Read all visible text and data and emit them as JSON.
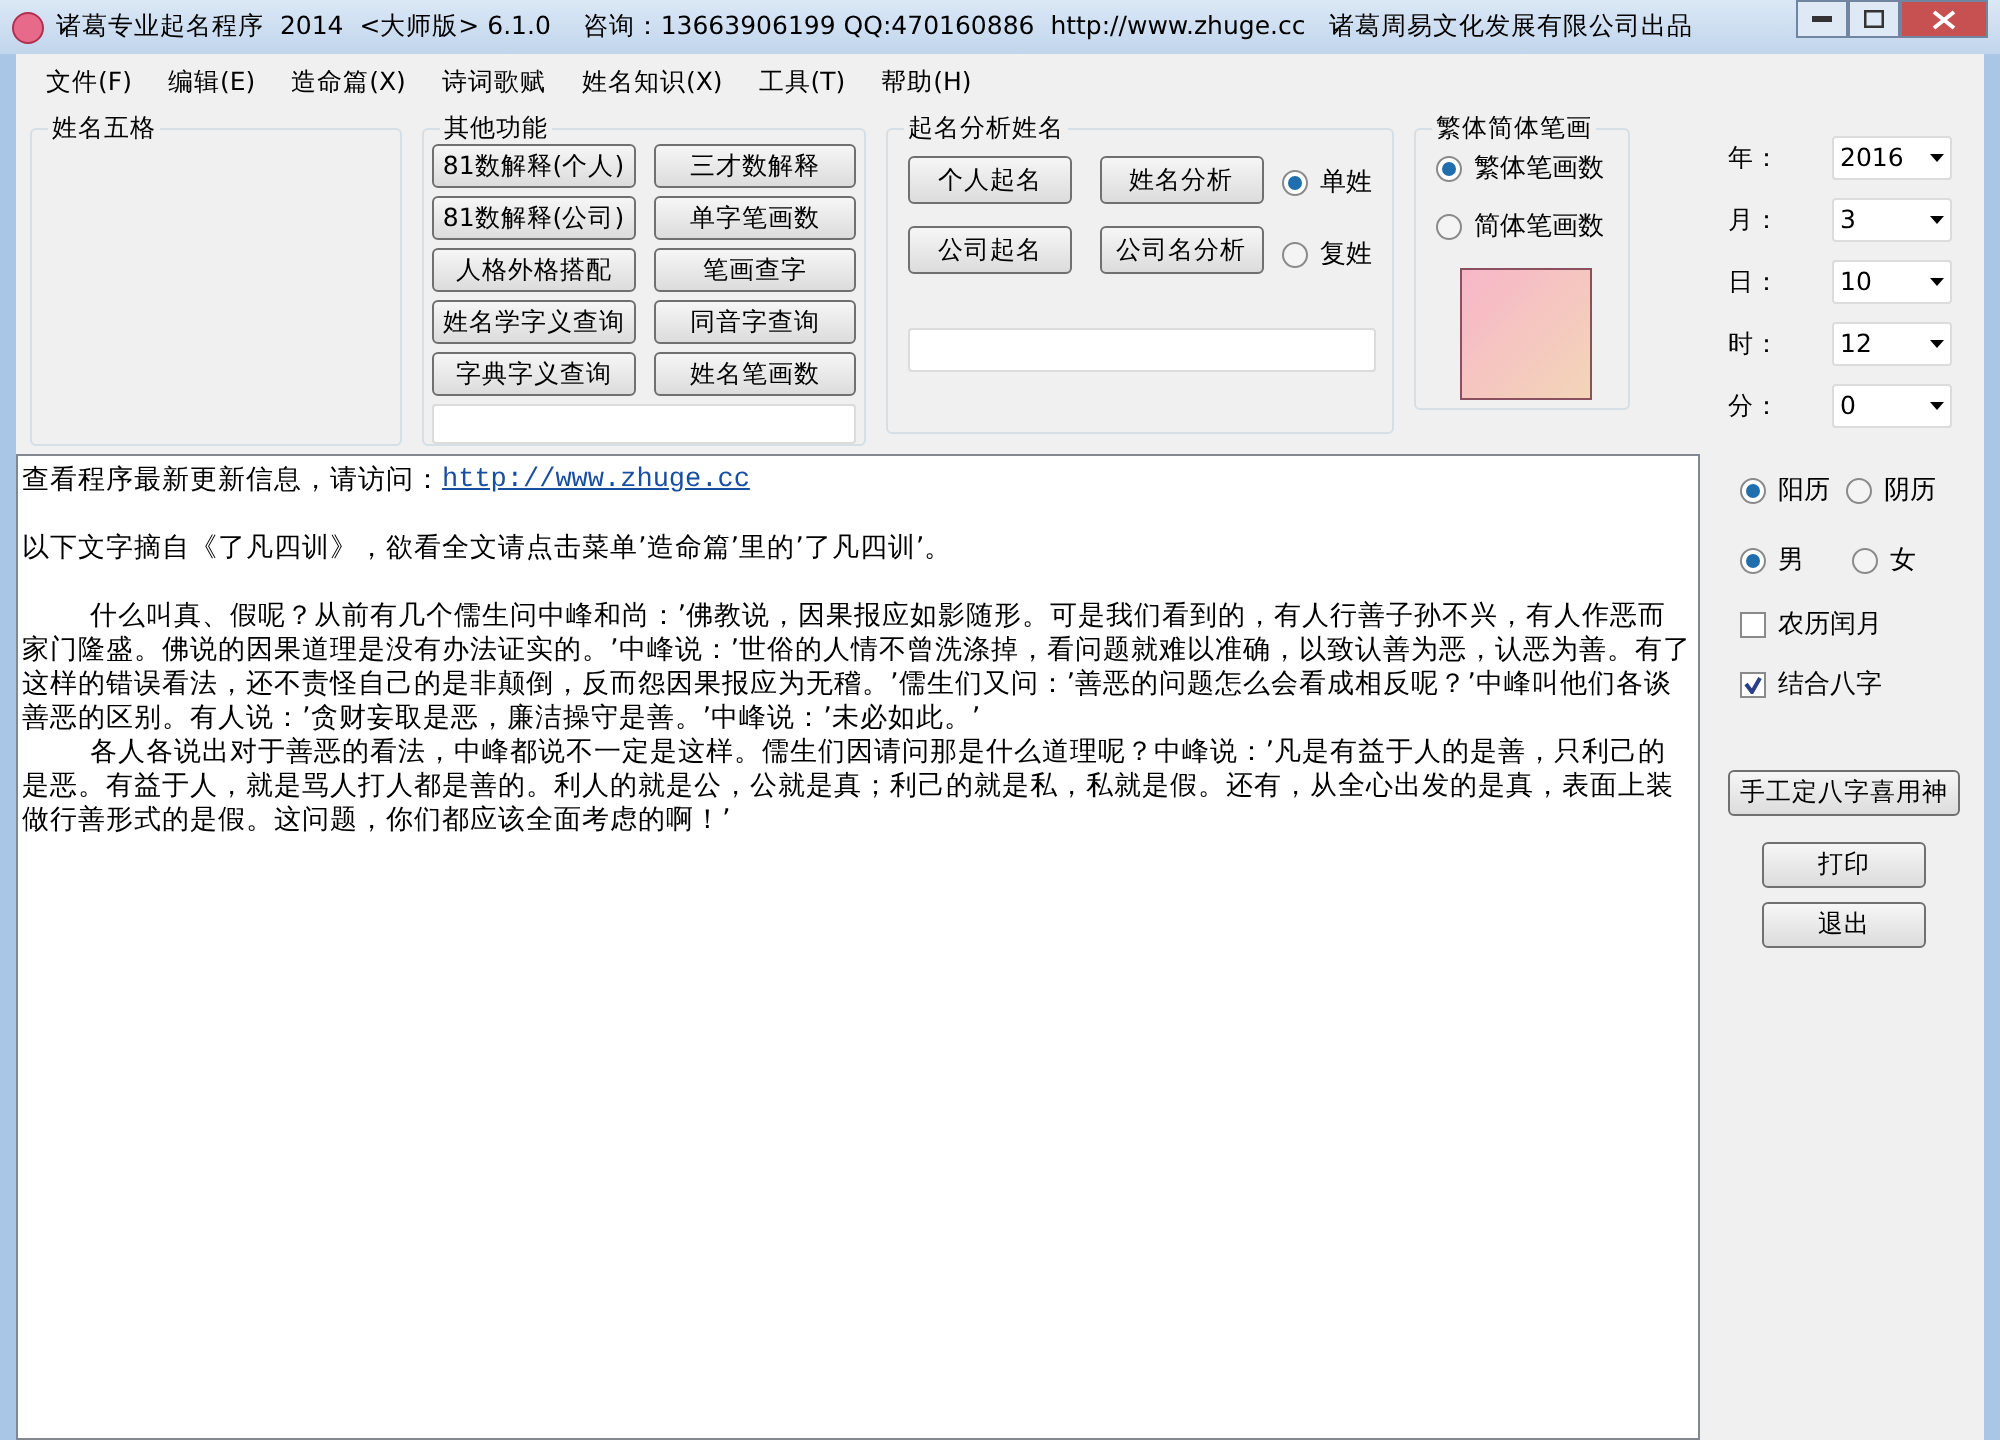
{
  "window": {
    "title": "诸葛专业起名程序  2014  <大师版> 6.1.0    咨询：13663906199 QQ:470160886  http://www.zhuge.cc   诸葛周易文化发展有限公司出品"
  },
  "menu": [
    "文件(F)",
    "编辑(E)",
    "造命篇(X)",
    "诗词歌赋",
    "姓名知识(X)",
    "工具(T)",
    "帮助(H)"
  ],
  "groups": {
    "wuge": {
      "title": "姓名五格"
    },
    "other": {
      "title": "其他功能",
      "buttons": [
        "81数解释(个人)",
        "三才数解释",
        "81数解释(公司)",
        "单字笔画数",
        "人格外格搭配",
        "笔画查字",
        "姓名学字义查询",
        "同音字查询",
        "字典字义查询",
        "姓名笔画数"
      ]
    },
    "naming": {
      "title": "起名分析姓名",
      "buttons": [
        "个人起名",
        "姓名分析",
        "公司起名",
        "公司名分析"
      ],
      "surname": [
        {
          "label": "单姓",
          "selected": true
        },
        {
          "label": "复姓",
          "selected": false
        }
      ]
    },
    "strokes": {
      "title": "繁体简体笔画",
      "options": [
        {
          "label": "繁体笔画数",
          "selected": true
        },
        {
          "label": "简体笔画数",
          "selected": false
        }
      ]
    }
  },
  "date_fields": [
    {
      "label": "年：",
      "value": "2016"
    },
    {
      "label": "月：",
      "value": "3"
    },
    {
      "label": "日：",
      "value": "10"
    },
    {
      "label": "时：",
      "value": "12"
    },
    {
      "label": "分：",
      "value": "0"
    }
  ],
  "calendar": [
    {
      "label": "阳历",
      "selected": true
    },
    {
      "label": "阴历",
      "selected": false
    }
  ],
  "gender": [
    {
      "label": "男",
      "selected": true
    },
    {
      "label": "女",
      "selected": false
    }
  ],
  "checkboxes": [
    {
      "label": "农历闰月",
      "checked": false
    },
    {
      "label": "结合八字",
      "checked": true
    }
  ],
  "side_buttons": [
    "手工定八字喜用神",
    "打印",
    "退出"
  ],
  "content": {
    "update_text": "查看程序最新更新信息，请访问：",
    "update_link": "http://www.zhuge.cc",
    "paragraphs": [
      {
        "text": "以下文字摘自《了凡四训》，欲看全文请点击菜单’造命篇’里的’了凡四训’。",
        "indent": false
      },
      {
        "text": "什么叫真、假呢？从前有几个儒生问中峰和尚：’佛教说，因果报应如影随形。可是我们看到的，有人行善子孙不兴，有人作恶而家门隆盛。佛说的因果道理是没有办法证实的。’中峰说：’世俗的人情不曾洗涤掉，看问题就难以准确，以致认善为恶，认恶为善。有了这样的错误看法，还不责怪自己的是非颠倒，反而怨因果报应为无稽。’儒生们又问：’善恶的问题怎么会看成相反呢？’中峰叫他们各谈善恶的区别。有人说：’贪财妄取是恶，廉洁操守是善。’中峰说：’未必如此。’",
        "indent": true
      },
      {
        "text": "各人各说出对于善恶的看法，中峰都说不一定是这样。儒生们因请问那是什么道理呢？中峰说：’凡是有益于人的是善，只利己的是恶。有益于人，就是骂人打人都是善的。利人的就是公，公就是真；利己的就是私，私就是假。还有，从全心出发的是真，表面上装做行善形式的是假。这问题，你们都应该全面考虑的啊！’",
        "indent": true
      }
    ]
  }
}
